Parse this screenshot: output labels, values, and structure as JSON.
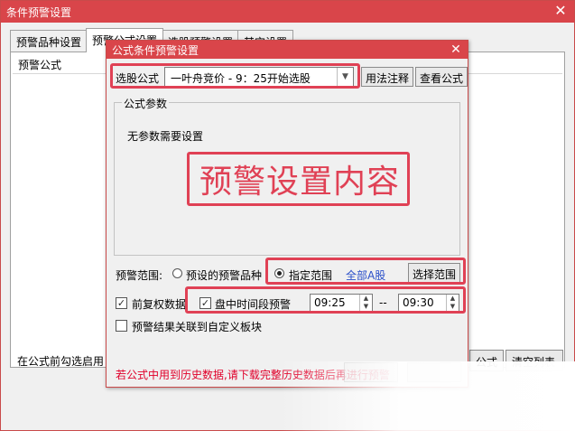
{
  "outer_window": {
    "title": "条件预警设置",
    "tabs": [
      {
        "label": "预警品种设置"
      },
      {
        "label": "预警公式设置"
      },
      {
        "label": "选股预警设置"
      },
      {
        "label": "其它设置"
      }
    ],
    "list_header": "预警公式",
    "bottom_text": "在公式前勾选启用",
    "buttons": {
      "gongshi": "公式",
      "clear_list": "清空列表"
    }
  },
  "dialog": {
    "title": "公式条件预警设置",
    "formula_label": "选股公式",
    "formula_value": "一叶舟竞价 - 9：25开始选股",
    "usage_note_btn": "用法注释",
    "view_formula_btn": "查看公式",
    "params_legend": "公式参数",
    "params_text": "无参数需要设置",
    "overlay_title": "预警设置内容",
    "range_label": "预警范围:",
    "range_preset": "预设的预警品种",
    "range_specified": "指定范围",
    "range_value": "全部A股",
    "select_range_btn": "选择范围",
    "pre_adjust": "前复权数据",
    "intraday": "盘中时间段预警",
    "time_start": "09:25",
    "time_sep": "--",
    "time_end": "09:30",
    "link_block": "预警结果关联到自定义板块",
    "warning": "若公式中用到历史数据,请下载完整历史数据后再进行预警"
  },
  "colors": {
    "titlebar": "#d9454a",
    "highlight": "#e04155",
    "link": "#2a4fc9",
    "warning": "#e0002a"
  }
}
